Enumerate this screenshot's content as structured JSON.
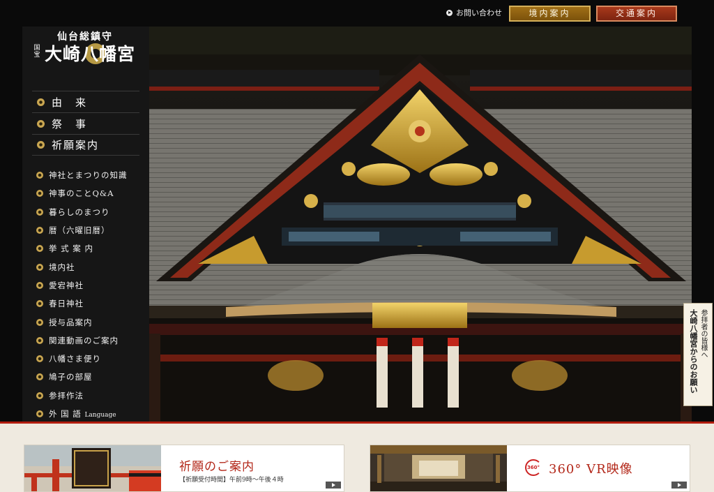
{
  "header": {
    "contact_label": "お問い合わせ",
    "precinct_label": "境内案内",
    "access_label": "交通案内"
  },
  "logo": {
    "subtitle": "仙台総鎮守",
    "kokuho": "国宝",
    "name": "大崎八幡宮"
  },
  "main_nav": [
    {
      "label": "由　来",
      "icon": "mon-icon"
    },
    {
      "label": "祭　事",
      "icon": "mon-icon"
    },
    {
      "label": "祈願案内",
      "icon": "mon-icon"
    }
  ],
  "sub_nav": [
    {
      "label": "神社とまつりの知識"
    },
    {
      "label": "神事のことQ&A"
    },
    {
      "label": "暮らしのまつり"
    },
    {
      "label": "暦（六曜旧暦）"
    },
    {
      "label": "挙 式 案 内"
    },
    {
      "label": "境内社"
    },
    {
      "label": "愛宕神社"
    },
    {
      "label": "春日神社"
    },
    {
      "label": "授与品案内"
    },
    {
      "label": "関連動画のご案内"
    },
    {
      "label": "八幡さま便り"
    },
    {
      "label": "鳩子の部屋"
    },
    {
      "label": "参拝作法"
    },
    {
      "label": "外 国 語",
      "sub": "Language"
    }
  ],
  "notice": {
    "line1": "参拝者の皆様へ",
    "line2": "大崎八幡宮からのお願い"
  },
  "cards": {
    "prayer": {
      "title": "祈願のご案内",
      "hours": "【祈願受付時間】午前9時～午後４時"
    },
    "vr": {
      "icon_text": "360°",
      "title": "360° VR映像"
    }
  },
  "colors": {
    "accent_red": "#b21d0f",
    "gold": "#c9a651",
    "background": "#0a0a0a"
  }
}
